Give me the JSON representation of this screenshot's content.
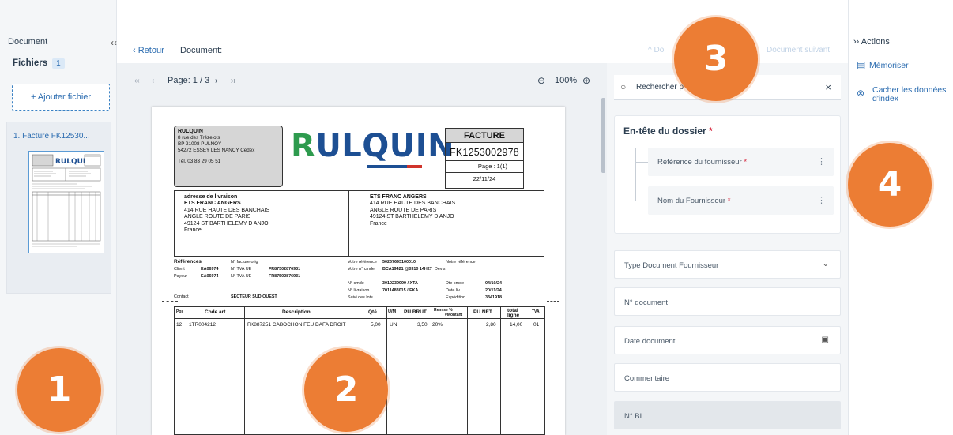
{
  "left_panel": {
    "title": "Document",
    "collapse_icon": "‹‹",
    "files_label": "Fichiers",
    "files_count": "1",
    "add_file": "+ Ajouter fichier",
    "file_item": "1.   Facture FK12530..."
  },
  "topbar": {
    "back": "‹  Retour",
    "doc_label": "Document:",
    "prev_doc": "^  Do",
    "next_doc": "Document suivant"
  },
  "viewer": {
    "first": "‹‹",
    "prev": "‹",
    "page_label": "Page: 1 / 3",
    "next": "›",
    "last": "››",
    "zoom_out_icon": "⊖",
    "zoom": "100%",
    "zoom_in_icon": "⊕"
  },
  "invoice": {
    "sender_name": "RULQUIN",
    "sender_l1": "8 rue des Trézelots",
    "sender_l2": "BP 21008 PULNOY",
    "sender_l3": "54272 ESSEY LES NANCY Cedex",
    "sender_tel": "Tél. 03 83 29 05 51",
    "logo_r": "R",
    "logo_rest": "ULQUIN",
    "doc_type": "FACTURE",
    "doc_number": "FK1253002978",
    "page_label": "Page :     1(1)",
    "date": "22/11/24",
    "delivery_title": "adresse de livraison",
    "delivery_name": "ETS FRANC ANGERS",
    "delivery_l1": "414 RUE HAUTE DES BANCHAIS",
    "delivery_l2": "ANGLE ROUTE DE PARIS",
    "delivery_l3": "49124 ST BARTHELEMY D ANJO",
    "delivery_l4": "France",
    "bill_name": "ETS FRANC ANGERS",
    "bill_l1": "414 RUE HAUTE DES BANCHAIS",
    "bill_l2": "ANGLE ROUTE DE PARIS",
    "bill_l3": "49124 ST BARTHELEMY D ANJO",
    "bill_l4": "France",
    "refs": {
      "references": "Références",
      "client": "Client",
      "client_val": "EA06974",
      "payeur": "Payeur",
      "payeur_val": "EA06974",
      "contact": "Contact",
      "secteur": "SECTEUR SUD OUEST",
      "nfacture": "N° facture orig",
      "tva1": "N° TVA UE",
      "tva1_val": "FR87502876931",
      "tva2": "N° TVA UE",
      "tva2_val": "FR87502876931",
      "votre_ref": "Votre référence",
      "votre_ref_val": "50267693100010",
      "notre_ref": "Notre référence",
      "votre_cmde": "Votre n° cmde",
      "votre_cmde_val": "BCA19421 @0310 14H27",
      "devis": "Devis",
      "ncmde": "N° cmde",
      "ncmde_val": "3010239999 / XTA",
      "dte_cmde": "Dte cmde",
      "dte_cmde_val": "04/10/24",
      "nliv": "N° livraison",
      "nliv_val": "7011483015 / FKA",
      "date_liv": "Date liv",
      "date_liv_val": "20/11/24",
      "suivi": "Suivi des lots",
      "expedition": "Expédition",
      "expedition_val": "3341918"
    },
    "table": {
      "headers": [
        "Pos",
        "Code art",
        "Description",
        "Qté",
        "U/M",
        "PU BRUT",
        "Remise    %",
        "PU NET",
        "total",
        "TVA"
      ],
      "headers_sub": [
        "#Montant",
        "ligne"
      ],
      "row": [
        "12",
        "1TR004212",
        "FK887251 CABOCHON FEU DAFA DROIT",
        "5,00",
        "UN",
        "3,50",
        "20%",
        "2,80",
        "14,00",
        "01"
      ]
    }
  },
  "form": {
    "search_placeholder": "Rechercher p",
    "close_icon": "×",
    "header_title": "En-tête du dossier",
    "required_mark": "*",
    "ref_fournisseur": "Référence du fournisseur",
    "nom_fournisseur": "Nom du Fournisseur",
    "type_doc": "Type Document Fournisseur",
    "num_doc": "N° document",
    "date_doc": "Date document",
    "commentaire": "Commentaire",
    "num_bl": "N° BL"
  },
  "actions": {
    "title": "››  Actions",
    "memoriser": "Mémoriser",
    "cacher": "Cacher les données d'index"
  },
  "annotations": [
    "1",
    "2",
    "3",
    "4"
  ],
  "colors": {
    "accent": "#2b6cb0",
    "circle": "#ec7d34",
    "logo_green": "#2e9b4e",
    "logo_blue": "#1d4f93",
    "required": "#d7263d"
  }
}
